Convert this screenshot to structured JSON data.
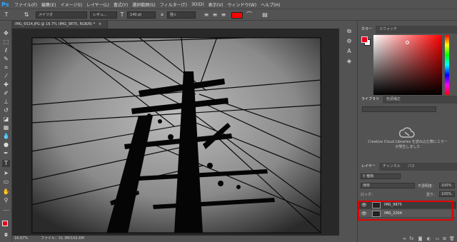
{
  "menu": {
    "logo": "Ps",
    "items": [
      "ファイル(F)",
      "編集(E)",
      "イメージ(I)",
      "レイヤー(L)",
      "書式(Y)",
      "選択範囲(S)",
      "フィルター(T)",
      "3D(D)",
      "表示(V)",
      "ウィンドウ(W)",
      "ヘルプ(H)"
    ]
  },
  "options": {
    "font_family": "メイリオ",
    "font_style": "レギュ...",
    "font_size": "140 pt",
    "aa_mode": "強く",
    "text_color": "#ff0000"
  },
  "document": {
    "tab_title": "IMG_6524.JPG @ 16.7% (IMG_9875, RGB/8) *",
    "zoom": "16.67%",
    "file_info": "ファイル：51.3M/102.6M"
  },
  "colors": {
    "foreground": "#e8001c",
    "background": "#ffffff",
    "highlight": "#e00000"
  },
  "color_panel": {
    "tabs": [
      "カラー",
      "スウォッチ"
    ]
  },
  "libraries_panel": {
    "tabs": [
      "ライブラリ",
      "色調補正"
    ],
    "message": "Creative Cloud Libraries を読み込む際にエラーが発生しました"
  },
  "layers_panel": {
    "tabs": [
      "レイヤー",
      "チャンネル",
      "パス"
    ],
    "filter_kind": "種類",
    "blend_mode": "通常",
    "opacity_label": "不透明度：",
    "opacity_value": "100%",
    "lock_label": "ロック：",
    "fill_label": "塗り：",
    "fill_value": "100%",
    "layers": [
      {
        "name": "IMG_9875",
        "selected": true
      },
      {
        "name": "IMG_2204",
        "selected": false
      }
    ]
  }
}
